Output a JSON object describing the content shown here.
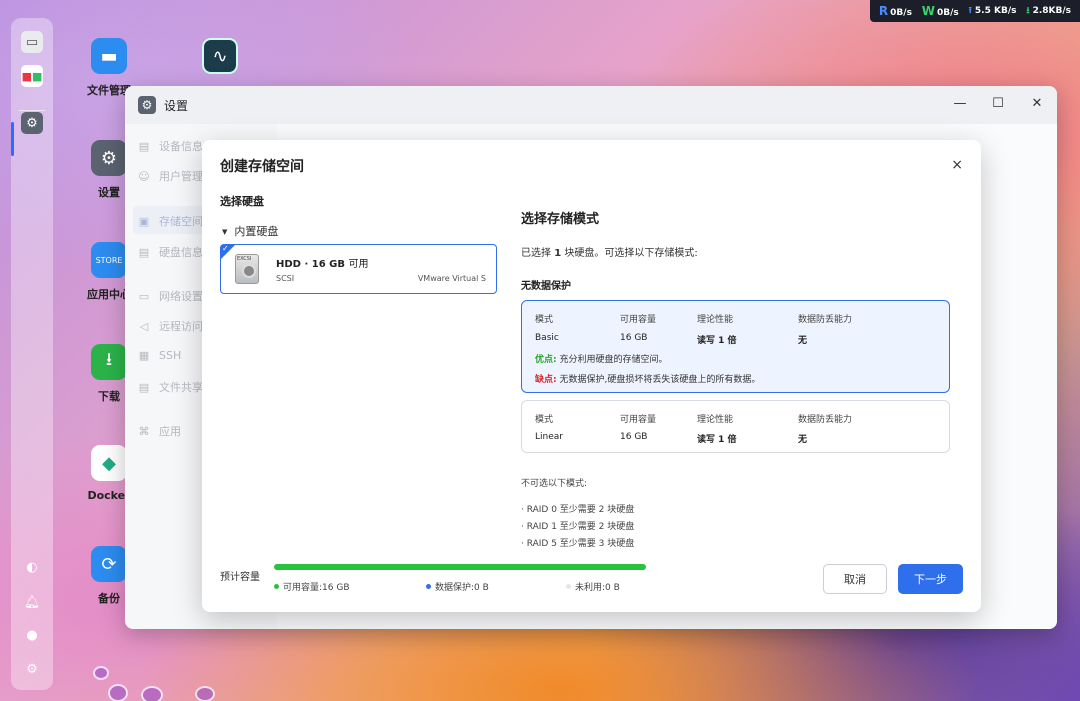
{
  "statusbar": {
    "read_label": "R",
    "read_value": "0B/s",
    "write_label": "W",
    "write_value": "0B/s",
    "upload_value": "5.5 KB/s",
    "download_value": "2.8KB/s"
  },
  "desktop": {
    "apps": [
      {
        "label": "文件管理",
        "icon": "folder-icon"
      },
      {
        "label": "",
        "icon": "monitor-chart-icon"
      },
      {
        "label": "设置",
        "icon": "gear-icon"
      },
      {
        "label": "应用中心",
        "icon": "store-icon"
      },
      {
        "label": "下载",
        "icon": "download-icon"
      },
      {
        "label": "Docker",
        "icon": "docker-icon"
      },
      {
        "label": "备份",
        "icon": "backup-icon"
      }
    ]
  },
  "window": {
    "title": "设置",
    "controls": {
      "minimize": "—",
      "maximize": "☐",
      "close": "✕"
    },
    "sidebar": [
      {
        "label": "设备信息",
        "icon": "device-icon"
      },
      {
        "label": "用户管理",
        "icon": "user-icon"
      },
      {
        "label": "存储空间",
        "icon": "storage-icon"
      },
      {
        "label": "硬盘信息",
        "icon": "disk-icon"
      },
      {
        "label": "网络设置",
        "icon": "network-icon"
      },
      {
        "label": "远程访问",
        "icon": "remote-icon"
      },
      {
        "label": "SSH",
        "icon": "ssh-icon"
      },
      {
        "label": "文件共享",
        "icon": "share-icon"
      },
      {
        "label": "应用",
        "icon": "apps-icon"
      }
    ]
  },
  "dialog": {
    "title": "创建存储空间",
    "close": "×",
    "select_disk_title": "选择硬盘",
    "tree_label": "内置硬盘",
    "disk": {
      "name": "HDD · 16 GB",
      "avail": "可用",
      "iface": "SCSI",
      "model": "VMware Virtual S",
      "icon_label": "EXCSI"
    },
    "mode_title": "选择存储模式",
    "mode_desc_pre": "已选择",
    "mode_desc_count": "1",
    "mode_desc_post": "块硬盘。可选择以下存储模式:",
    "no_protection": "无数据保护",
    "headers": {
      "mode": "模式",
      "capacity": "可用容量",
      "perf": "理论性能",
      "fault": "数据防丢能力"
    },
    "modes": [
      {
        "name": "Basic",
        "capacity": "16 GB",
        "perf": "读写 1 倍",
        "fault": "无",
        "pro_label": "优点:",
        "pro_text": "充分利用硬盘的存储空间。",
        "con_label": "缺点:",
        "con_text": "无数据保护,硬盘损坏将丢失该硬盘上的所有数据。"
      },
      {
        "name": "Linear",
        "capacity": "16 GB",
        "perf": "读写 1 倍",
        "fault": "无"
      }
    ],
    "unavailable_title": "不可选以下模式:",
    "unavailable": [
      "· RAID 0 至少需要 2 块硬盘",
      "· RAID 1 至少需要 2 块硬盘",
      "· RAID 5 至少需要 3 块硬盘"
    ],
    "footer": {
      "estimate_label": "预计容量",
      "usable_fraction": 1.0,
      "legend_usable": "可用容量:16 GB",
      "legend_protect": "数据保护:0 B",
      "legend_unused": "未利用:0 B",
      "cancel": "取消",
      "next": "下一步"
    }
  },
  "colors": {
    "accent": "#2f6fec",
    "usable": "#28c23c",
    "pro": "#2aa62a",
    "con": "#e0242c"
  }
}
